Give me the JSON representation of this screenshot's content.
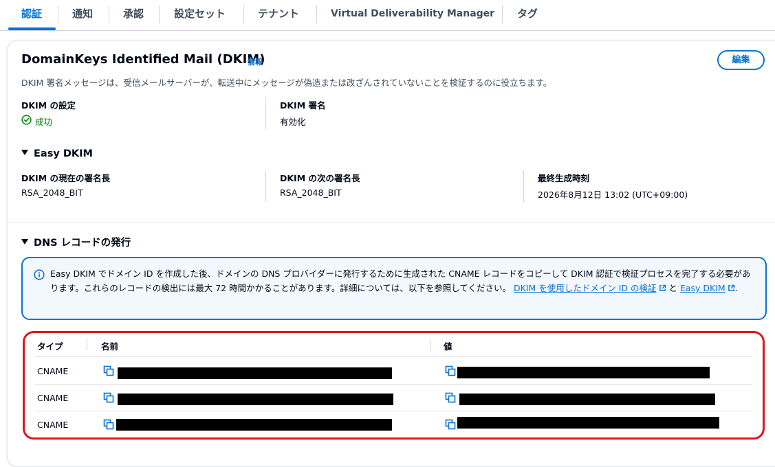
{
  "tabs": [
    {
      "label": "認証",
      "active": true
    },
    {
      "label": "通知"
    },
    {
      "label": "承認"
    },
    {
      "label": "設定セット"
    },
    {
      "label": "テナント"
    },
    {
      "label": "Virtual Deliverability Manager"
    },
    {
      "label": "タグ"
    }
  ],
  "dkim": {
    "title": "DomainKeys Identified Mail (DKIM)",
    "info_link": "情報",
    "edit_button": "編集",
    "description": "DKIM 署名メッセージは、受信メールサーバーが、転送中にメッセージが偽造または改ざんされていないことを検証するのに役立ちます。",
    "settings_label": "DKIM の設定",
    "settings_value": "成功",
    "signing_label": "DKIM 署名",
    "signing_value": "有効化"
  },
  "easy_dkim": {
    "heading": "Easy DKIM",
    "current_label": "DKIM の現在の署名長",
    "current_value": "RSA_2048_BIT",
    "next_label": "DKIM の次の署名長",
    "next_value": "RSA_2048_BIT",
    "generated_label": "最終生成時刻",
    "generated_value": "2026年8月12日 13:02 (UTC+09:00)"
  },
  "dns": {
    "heading": "DNS レコードの発行",
    "alert_text_1": "Easy DKIM でドメイン ID を作成した後、ドメインの DNS プロバイダーに発行するために生成された CNAME レコードをコピーして DKIM 認証で検証プロセスを完了する必要があります。これらのレコードの検出には最大 72 時間かかることがあります。詳細については、以下を参照してください。",
    "alert_link_1": "DKIM を使用したドメイン ID の検証",
    "alert_and": "と",
    "alert_link_2": "Easy DKIM",
    "alert_end": ".",
    "table": {
      "columns": [
        "タイプ",
        "名前",
        "値"
      ],
      "rows": [
        {
          "type": "CNAME"
        },
        {
          "type": "CNAME"
        },
        {
          "type": "CNAME"
        }
      ]
    }
  },
  "colors": {
    "accent": "#0972d3",
    "success": "#037f0c",
    "highlight": "#e0141e",
    "redaction": "#000000"
  }
}
